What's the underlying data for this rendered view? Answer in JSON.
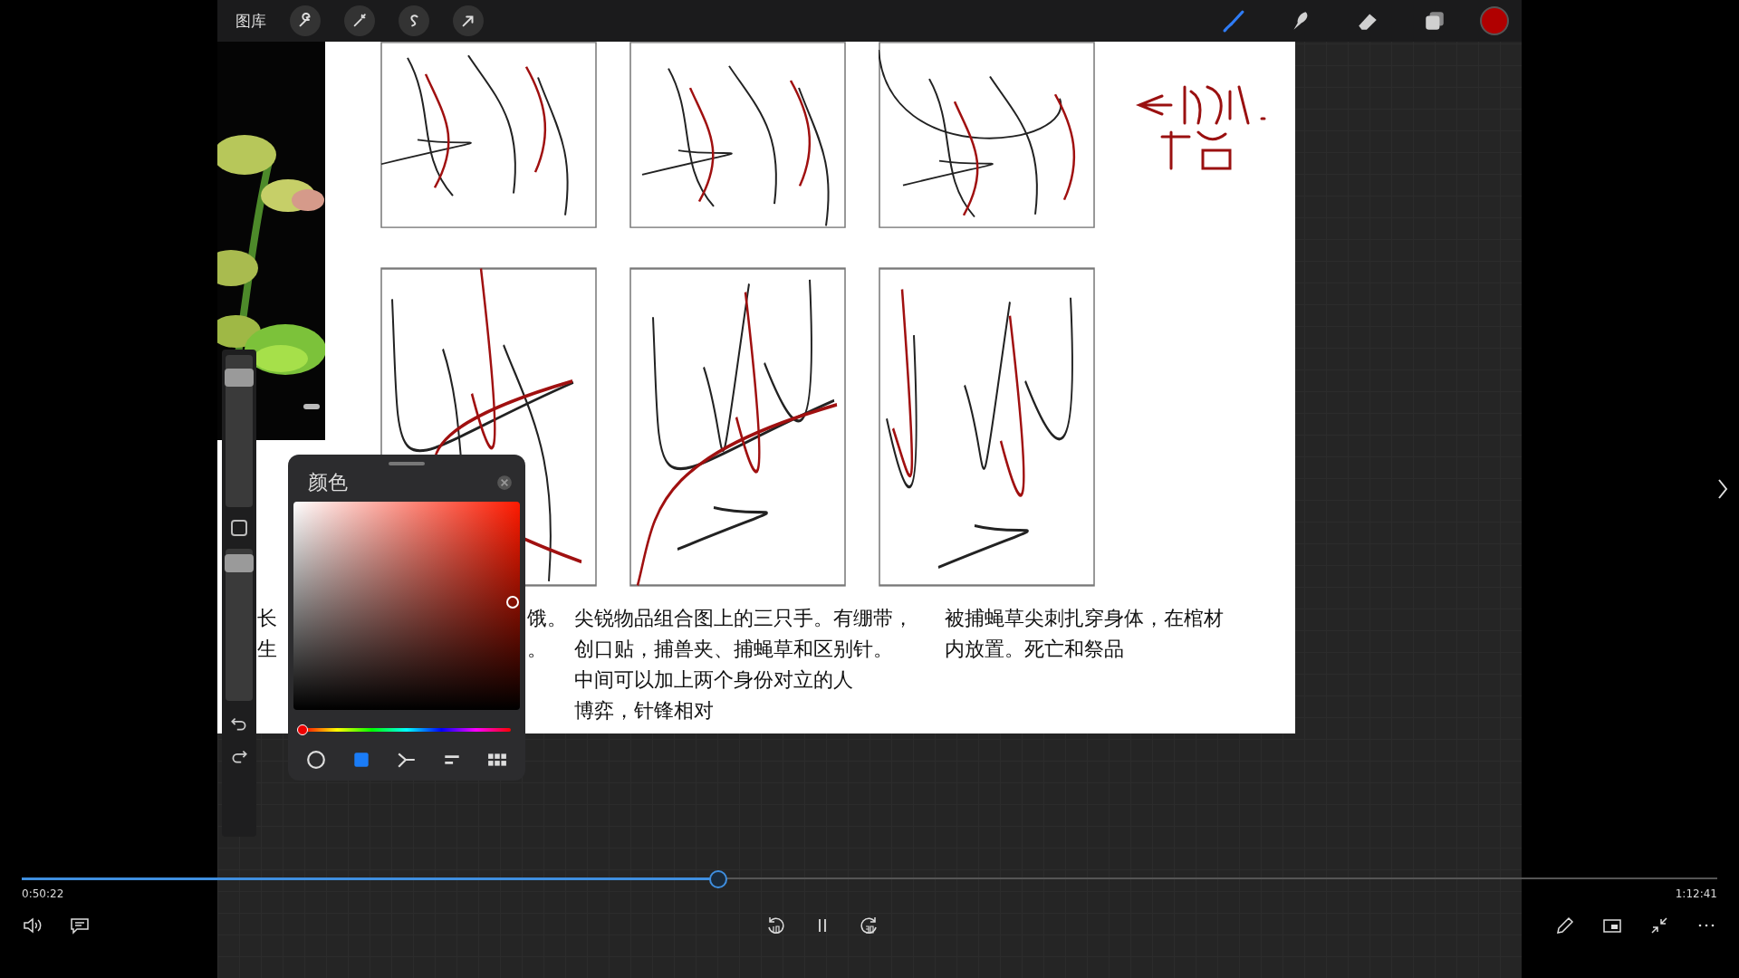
{
  "procreate": {
    "gallery_label": "图库",
    "left_tools": [
      {
        "kind": "wrench"
      },
      {
        "kind": "wand"
      },
      {
        "kind": "select"
      },
      {
        "kind": "transform"
      }
    ],
    "right_tools": [
      {
        "kind": "brush",
        "selected": true
      },
      {
        "kind": "smudge",
        "selected": false
      },
      {
        "kind": "eraser",
        "selected": false
      },
      {
        "kind": "layers",
        "selected": false
      }
    ],
    "sidebar": {
      "size_slider": {
        "level": 0.88
      },
      "opacity_slider": {
        "level": 0.95
      }
    },
    "color_panel": {
      "title": "颜色",
      "hue": {
        "level": 0.0
      },
      "modes": [
        {
          "kind": "disc",
          "selected": false
        },
        {
          "kind": "classic",
          "selected": true
        },
        {
          "kind": "harmony",
          "selected": false
        },
        {
          "kind": "value",
          "selected": false
        },
        {
          "kind": "palettes",
          "selected": false
        }
      ]
    },
    "canvas": {
      "notes": [
        {
          "lines": [
            "长",
            "生"
          ]
        },
        {
          "lines": [
            "饿。",
            "。"
          ]
        },
        {
          "lines": [
            "尖锐物品组合图上的三只手。有绷带，",
            "创口贴，捕兽夹、捕蝇草和区别针。",
            "中间可以加上两个身份对立的人",
            "博弈，针锋相对"
          ]
        },
        {
          "lines": [
            "被捕蝇草尖刺扎穿身体，在棺材",
            "内放置。死亡和祭品"
          ]
        }
      ]
    }
  },
  "player": {
    "progress": {
      "level": 0.41
    },
    "elapsed": "0:50:22",
    "duration": "1:12:41",
    "playing": true
  }
}
